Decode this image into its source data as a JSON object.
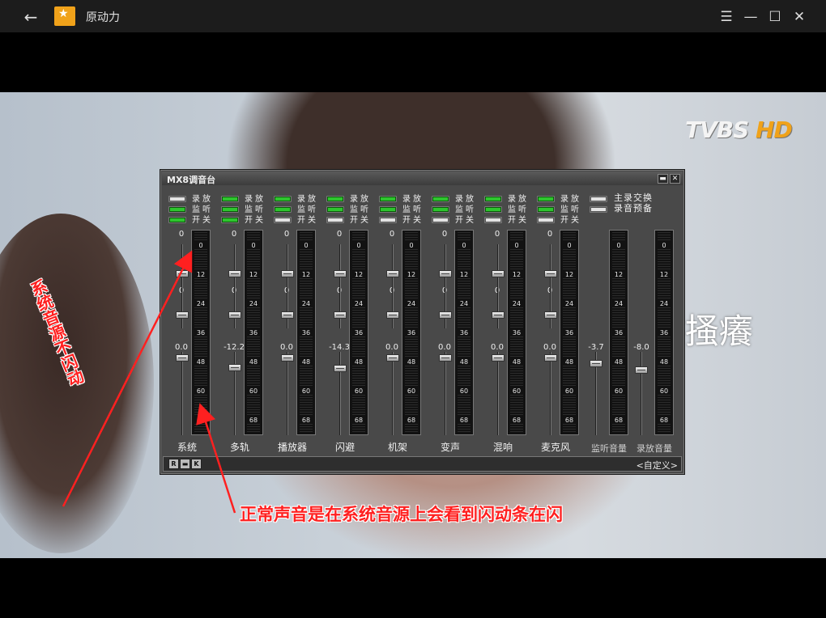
{
  "window": {
    "title": "原动力",
    "back_glyph": "←",
    "menu_glyph": "☰",
    "minimize_glyph": "—",
    "maximize_glyph": "☐",
    "close_glyph": "✕"
  },
  "video": {
    "logo_text": "TVBS",
    "logo_hd": "HD",
    "subtitle_fragment": "搔癢"
  },
  "annotations": {
    "left_note": "系统音源不闪动",
    "bottom_note": "正常声音是在系统音源上会看到闪动条在闪"
  },
  "mixer": {
    "title": "MX8调音台",
    "minimize_glyph": "▬",
    "close_glyph": "✕",
    "switch_labels": [
      "录放",
      "监听",
      "开关"
    ],
    "global_switches": [
      {
        "label": "主录交换",
        "on": false
      },
      {
        "label": "录音预备",
        "on": false
      }
    ],
    "meter_ticks": [
      "0",
      "12",
      "24",
      "36",
      "48",
      "60",
      "68"
    ],
    "channels": [
      {
        "name": "系统",
        "top": "0",
        "mid": "0",
        "value": "0.0",
        "upper_level": 0.22,
        "lower_level": 0.0,
        "switches": [
          false,
          true,
          true
        ]
      },
      {
        "name": "多轨",
        "top": "0",
        "mid": "0",
        "value": "-12.2",
        "upper_level": 0.0,
        "lower_level": 0.12,
        "switches": [
          true,
          true,
          true
        ]
      },
      {
        "name": "播放器",
        "top": "0",
        "mid": "0",
        "value": "0.0",
        "upper_level": 0.22,
        "lower_level": 0.0,
        "switches": [
          true,
          true,
          false
        ]
      },
      {
        "name": "闪避",
        "top": "0",
        "mid": "0",
        "value": "-14.3",
        "upper_level": 0.22,
        "lower_level": 0.13,
        "switches": [
          true,
          true,
          false
        ]
      },
      {
        "name": "机架",
        "top": "0",
        "mid": "0",
        "value": "0.0",
        "upper_level": 0.22,
        "lower_level": 0.0,
        "switches": [
          true,
          true,
          false
        ]
      },
      {
        "name": "变声",
        "top": "0",
        "mid": "0",
        "value": "0.0",
        "upper_level": 0.22,
        "lower_level": 0.0,
        "switches": [
          true,
          true,
          false
        ]
      },
      {
        "name": "混响",
        "top": "0",
        "mid": "0",
        "value": "0.0",
        "upper_level": 0.22,
        "lower_level": 0.0,
        "switches": [
          true,
          true,
          false
        ]
      },
      {
        "name": "麦克风",
        "top": "0",
        "mid": "0",
        "value": "0.0",
        "upper_level": 0.22,
        "lower_level": 0.0,
        "switches": [
          true,
          true,
          false
        ]
      }
    ],
    "output_channels": [
      {
        "name": "监听音量",
        "value": "-3.7"
      },
      {
        "name": "录放音量",
        "value": "-8.0"
      }
    ],
    "status_buttons": [
      "R",
      "▬",
      "K"
    ],
    "preset_name": "<自定义>"
  },
  "colors": {
    "annotation": "#ff2020",
    "led_on": "#2ec52e",
    "mixer_bg": "#494949"
  }
}
